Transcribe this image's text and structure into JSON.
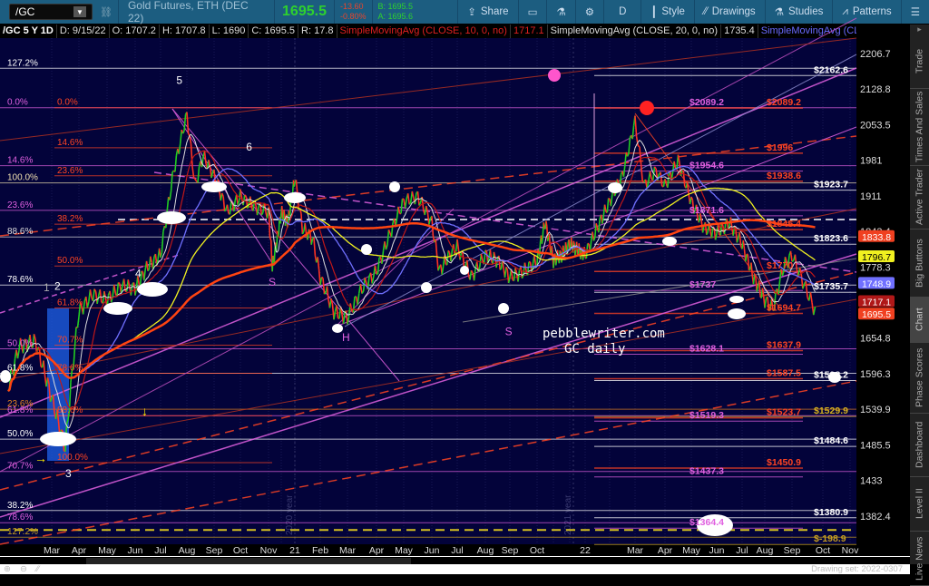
{
  "toolbar": {
    "symbol": "/GC",
    "title": "Gold Futures, ETH (DEC 22)",
    "last": "1695.5",
    "change": "-13.60",
    "change_pct": "-0.80%",
    "bid": "B: 1695.5",
    "ask": "A: 1695.6",
    "share": "Share",
    "interval": "D",
    "style": "Style",
    "drawings": "Drawings",
    "studies": "Studies",
    "patterns": "Patterns"
  },
  "infobar": {
    "symbol": "/GC 5 Y 1D",
    "date": "D: 9/15/22",
    "open": "O: 1707.2",
    "high": "H: 1707.8",
    "low": "L: 1690",
    "close": "C: 1695.5",
    "range": "R: 17.8",
    "sma10": "SimpleMovingAvg (CLOSE, 10, 0, no)",
    "sma10_val": "1717.1",
    "sma20": "SimpleMovingAvg (CLOSE, 20, 0, no)",
    "sma20_val": "1735.4",
    "sma3": "SimpleMovingAvg (CLOSE,..."
  },
  "right_tabs": [
    {
      "label": "Trade"
    },
    {
      "label": "Times And Sales"
    },
    {
      "label": "Active Trader"
    },
    {
      "label": "Big Buttons"
    },
    {
      "label": "Chart",
      "selected": true
    },
    {
      "label": "Phase Scores"
    },
    {
      "label": "Dashboard"
    },
    {
      "label": "Level II"
    },
    {
      "label": "Live News"
    }
  ],
  "bottombar": {
    "drawing_set": "Drawing set: 2022-0307"
  },
  "chart_data": {
    "type": "line",
    "scale": "log",
    "ylim": [
      1382.4,
      2206.7
    ],
    "y_ticks": [
      "2206.7",
      "2128.8",
      "2053.5",
      "1981",
      "1911",
      "1843.4",
      "1778.3",
      "1654.8",
      "1596.3",
      "1539.9",
      "1485.5",
      "1433",
      "1382.4"
    ],
    "x_ticks": [
      "Mar",
      "Apr",
      "May",
      "Jun",
      "Jul",
      "Aug",
      "Sep",
      "Oct",
      "Nov",
      "",
      "21",
      "Feb",
      "Mar",
      "Apr",
      "May",
      "Jun",
      "Jul",
      "Aug",
      "Sep",
      "Oct",
      "",
      "",
      "22",
      "",
      "Mar",
      "Apr",
      "May",
      "Jun",
      "Jul",
      "Aug",
      "Sep",
      "Oct",
      "Nov"
    ],
    "price": [
      [
        -1.6,
        1575
      ],
      [
        -1.2,
        1640
      ],
      [
        -0.6,
        1650
      ],
      [
        0.5,
        1480
      ],
      [
        0.8,
        1620
      ],
      [
        1,
        1700
      ],
      [
        1.5,
        1730
      ],
      [
        2,
        1720
      ],
      [
        2.5,
        1745
      ],
      [
        3,
        1740
      ],
      [
        3.5,
        1780
      ],
      [
        4,
        1800
      ],
      [
        4.5,
        1960
      ],
      [
        5,
        2075
      ],
      [
        5.3,
        1930
      ],
      [
        5.6,
        1990
      ],
      [
        6,
        1950
      ],
      [
        6.5,
        1880
      ],
      [
        7,
        1910
      ],
      [
        7.5,
        1890
      ],
      [
        8,
        1880
      ],
      [
        8.3,
        1780
      ],
      [
        8.7,
        1830
      ],
      [
        9,
        1880
      ],
      [
        9.5,
        1860
      ],
      [
        10,
        1945
      ],
      [
        10.3,
        1850
      ],
      [
        10.7,
        1830
      ],
      [
        11,
        1760
      ],
      [
        11.5,
        1700
      ],
      [
        12,
        1690
      ],
      [
        12.5,
        1740
      ],
      [
        13,
        1770
      ],
      [
        13.5,
        1840
      ],
      [
        14,
        1900
      ],
      [
        14.5,
        1910
      ],
      [
        15,
        1860
      ],
      [
        15.3,
        1770
      ],
      [
        15.7,
        1800
      ],
      [
        16,
        1815
      ],
      [
        16.5,
        1760
      ],
      [
        17,
        1800
      ],
      [
        17.5,
        1790
      ],
      [
        18,
        1760
      ],
      [
        18.5,
        1770
      ],
      [
        19,
        1790
      ],
      [
        19.5,
        1860
      ],
      [
        20,
        1790
      ],
      [
        20.5,
        1800
      ],
      [
        21,
        1820
      ],
      [
        22,
        1800
      ],
      [
        22.5,
        1850
      ],
      [
        23,
        1900
      ],
      [
        23.5,
        1950
      ],
      [
        24,
        2060
      ],
      [
        24.3,
        1930
      ],
      [
        24.7,
        1960
      ],
      [
        25,
        1930
      ],
      [
        25.5,
        1980
      ],
      [
        26,
        1900
      ],
      [
        26.5,
        1850
      ],
      [
        27,
        1840
      ],
      [
        27.5,
        1860
      ],
      [
        28,
        1820
      ],
      [
        28.5,
        1760
      ],
      [
        29,
        1720
      ],
      [
        29.3,
        1705
      ],
      [
        29.7,
        1780
      ],
      [
        30,
        1800
      ],
      [
        30.3,
        1760
      ],
      [
        30.6,
        1720
      ],
      [
        30.8,
        1695.5
      ]
    ],
    "fib_left": [
      {
        "label": "127.2%",
        "price": 2174,
        "color": "#ffffff",
        "col": "a"
      },
      {
        "label": "0.0%",
        "price": 2089,
        "color": "#e060e0",
        "col": "a"
      },
      {
        "label": "0.0%",
        "price": 2089,
        "color": "#ff4422",
        "col": "b"
      },
      {
        "label": "14.6%",
        "price": 2006,
        "color": "#ff4422",
        "col": "b"
      },
      {
        "label": "14.6%",
        "price": 1970,
        "color": "#e060e0",
        "col": "a"
      },
      {
        "label": "23.6%",
        "price": 1950,
        "color": "#ff4422",
        "col": "b"
      },
      {
        "label": "100.0%",
        "price": 1936,
        "color": "#f0e0b0",
        "col": "a"
      },
      {
        "label": "23.6%",
        "price": 1883,
        "color": "#e060e0",
        "col": "a"
      },
      {
        "label": "38.2%",
        "price": 1857,
        "color": "#ff4422",
        "col": "b"
      },
      {
        "label": "88.6%",
        "price": 1833,
        "color": "#dddddd",
        "col": "a"
      },
      {
        "label": "50.0%",
        "price": 1780,
        "color": "#ff4422",
        "col": "b"
      },
      {
        "label": "78.6%",
        "price": 1746,
        "color": "#ffffff",
        "col": "a"
      },
      {
        "label": "61.8%",
        "price": 1706,
        "color": "#ff4422",
        "col": "b"
      },
      {
        "label": "50.0%",
        "price": 1637,
        "color": "#e060e0",
        "col": "a"
      },
      {
        "label": "70.7%",
        "price": 1643,
        "color": "#ff4422",
        "col": "b"
      },
      {
        "label": "61.8%",
        "price": 1597,
        "color": "#ffffff",
        "col": "a"
      },
      {
        "label": "78.6%",
        "price": 1597,
        "color": "#ff4422",
        "col": "b"
      },
      {
        "label": "23.6%",
        "price": 1540,
        "color": "#e08020",
        "col": "a"
      },
      {
        "label": "61.8%",
        "price": 1530,
        "color": "#e060e0",
        "col": "a"
      },
      {
        "label": "88.6%",
        "price": 1530,
        "color": "#ff4422",
        "col": "b"
      },
      {
        "label": "50.0%",
        "price": 1494,
        "color": "#ffffff",
        "col": "a"
      },
      {
        "label": "100.0%",
        "price": 1459,
        "color": "#ff4422",
        "col": "b"
      },
      {
        "label": "70.7%",
        "price": 1446,
        "color": "#e060e0",
        "col": "a"
      },
      {
        "label": "38.2%",
        "price": 1390,
        "color": "#ffffff",
        "col": "a"
      },
      {
        "label": "78.6%",
        "price": 1373,
        "color": "#e060e0",
        "col": "a"
      },
      {
        "label": "127.2%",
        "price": 1353,
        "color": "#c8a020",
        "col": "a"
      }
    ],
    "fib_right": [
      {
        "label": "$2162.6",
        "price": 2174,
        "color": "#ffffff",
        "col": "w"
      },
      {
        "label": "$2089.2",
        "price": 2100,
        "color": "#e060e0",
        "col": "m"
      },
      {
        "label": "$2089.2",
        "price": 2100,
        "color": "#ff4422",
        "col": "r"
      },
      {
        "label": "$1996",
        "price": 2006,
        "color": "#ff4422",
        "col": "r"
      },
      {
        "label": "$1954.6",
        "price": 1970,
        "color": "#e060e0",
        "col": "m"
      },
      {
        "label": "$1938.6",
        "price": 1950,
        "color": "#ff4422",
        "col": "r"
      },
      {
        "label": "$1923.7",
        "price": 1936,
        "color": "#ffffff",
        "col": "w"
      },
      {
        "label": "$1871.6",
        "price": 1883,
        "color": "#e060e0",
        "col": "m"
      },
      {
        "label": "$1845.4",
        "price": 1857,
        "color": "#ff4422",
        "col": "r"
      },
      {
        "label": "$1823.6",
        "price": 1833,
        "color": "#ffffff",
        "col": "w"
      },
      {
        "label": "$1770",
        "price": 1780,
        "color": "#ff4422",
        "col": "r"
      },
      {
        "label": "$1737",
        "price": 1746,
        "color": "#e060e0",
        "col": "m"
      },
      {
        "label": "$1735.7",
        "price": 1746,
        "color": "#ffffff",
        "col": "w"
      },
      {
        "label": "$1694.7",
        "price": 1706,
        "color": "#ff4422",
        "col": "r"
      },
      {
        "label": "$1637.9",
        "price": 1643,
        "color": "#ff4422",
        "col": "r"
      },
      {
        "label": "$1628.1",
        "price": 1637,
        "color": "#e060e0",
        "col": "m"
      },
      {
        "label": "$1587.5",
        "price": 1597,
        "color": "#ff4422",
        "col": "r"
      },
      {
        "label": "$1598.2",
        "price": 1597,
        "color": "#ffffff",
        "col": "w"
      },
      {
        "label": "$1529.9",
        "price": 1540,
        "color": "#d4b020",
        "col": "w"
      },
      {
        "label": "$1523.7",
        "price": 1535,
        "color": "#ff4422",
        "col": "r"
      },
      {
        "label": "$1519.3",
        "price": 1530,
        "color": "#e060e0",
        "col": "m"
      },
      {
        "label": "$1484.6",
        "price": 1494,
        "color": "#ffffff",
        "col": "w"
      },
      {
        "label": "$1450.9",
        "price": 1459,
        "color": "#ff4422",
        "col": "r"
      },
      {
        "label": "$1437.3",
        "price": 1446,
        "color": "#e060e0",
        "col": "m"
      },
      {
        "label": "$1380.9",
        "price": 1390,
        "color": "#ffffff",
        "col": "w"
      },
      {
        "label": "$1364.4",
        "price": 1373,
        "color": "#e060e0",
        "col": "m"
      },
      {
        "label": "$-198.9",
        "price": 1353,
        "color": "#c8a020",
        "col": "w"
      }
    ],
    "price_badges": [
      {
        "value": "1833.8",
        "color": "#f04020"
      },
      {
        "value": "1796.7",
        "color": "#f0f020"
      },
      {
        "value": "1748.9",
        "color": "#7070ff"
      },
      {
        "value": "1717.1",
        "color": "#b01818"
      },
      {
        "value": "1695.5",
        "color": "#f04020"
      }
    ],
    "badge_prices": [
      1833.8,
      1796.7,
      1748.9,
      1717.1,
      1695.5
    ],
    "annotations": [
      {
        "text": "5",
        "m": 4.6,
        "price": 2140,
        "color": "#ffffff"
      },
      {
        "text": "6",
        "m": 7.2,
        "price": 2000,
        "color": "#ffffff"
      },
      {
        "text": "4",
        "m": 3,
        "price": 1760,
        "color": "#ffffff"
      },
      {
        "text": "1",
        "m": -0.3,
        "price": 1735,
        "color": "#aaaaaa"
      },
      {
        "text": "2",
        "m": 0.1,
        "price": 1738,
        "color": "#ffffff"
      },
      {
        "text": "3",
        "m": 0.5,
        "price": 1438,
        "color": "#ffffff"
      },
      {
        "text": "S",
        "m": 8,
        "price": 1745,
        "color": "#e060e0"
      },
      {
        "text": "H",
        "m": 11.8,
        "price": 1650,
        "color": "#e060e0"
      },
      {
        "text": "S",
        "m": 17.8,
        "price": 1660,
        "color": "#e060e0"
      }
    ],
    "watermark": [
      "pebblewriter.com",
      "GC daily"
    ],
    "year_markers": [
      "2020 year",
      "2021 year"
    ]
  }
}
